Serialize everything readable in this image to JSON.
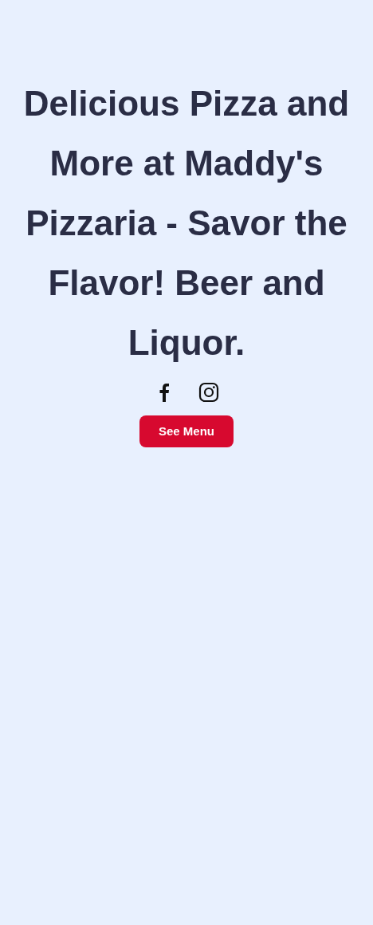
{
  "heading": "Delicious Pizza and More at Maddy's Pizzaria - Savor the Flavor! Beer and Liquor.",
  "social_links": [
    {
      "kind": "facebook"
    },
    {
      "kind": "instagram"
    }
  ],
  "button": "See Menu"
}
